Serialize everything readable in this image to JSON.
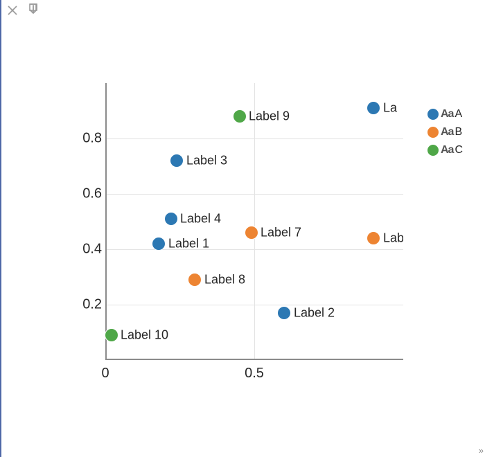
{
  "toolbar": {
    "close": "close-icon",
    "download": "download-icon"
  },
  "chart_data": {
    "type": "scatter",
    "title": "",
    "xlabel": "",
    "ylabel": "",
    "xlim": [
      0,
      1
    ],
    "ylim": [
      0,
      1
    ],
    "x_ticks": [
      0,
      0.5
    ],
    "y_ticks": [
      0.2,
      0.4,
      0.6,
      0.8
    ],
    "grid": true,
    "legend_position": "right",
    "series": [
      {
        "name": "A",
        "color": "#2c78b3",
        "points": [
          {
            "x": 0.18,
            "y": 0.42,
            "label": "Label 1"
          },
          {
            "x": 0.6,
            "y": 0.17,
            "label": "Label 2"
          },
          {
            "x": 0.24,
            "y": 0.72,
            "label": "Label 3"
          },
          {
            "x": 0.22,
            "y": 0.51,
            "label": "Label 4"
          },
          {
            "x": 0.9,
            "y": 0.91,
            "label": "La"
          }
        ]
      },
      {
        "name": "B",
        "color": "#ed8432",
        "points": [
          {
            "x": 0.9,
            "y": 0.44,
            "label": "Lab"
          },
          {
            "x": 0.49,
            "y": 0.46,
            "label": "Label 7"
          },
          {
            "x": 0.3,
            "y": 0.29,
            "label": "Label 8"
          }
        ]
      },
      {
        "name": "C",
        "color": "#4fa748",
        "points": [
          {
            "x": 0.45,
            "y": 0.88,
            "label": "Label 9"
          },
          {
            "x": 0.02,
            "y": 0.09,
            "label": "Label 10"
          }
        ]
      }
    ],
    "legend": [
      {
        "aa": "Aa",
        "name": "A",
        "color": "#2c78b3"
      },
      {
        "aa": "Aa",
        "name": "B",
        "color": "#ed8432"
      },
      {
        "aa": "Aa",
        "name": "C",
        "color": "#4fa748"
      }
    ]
  },
  "resize_glyph": "»"
}
